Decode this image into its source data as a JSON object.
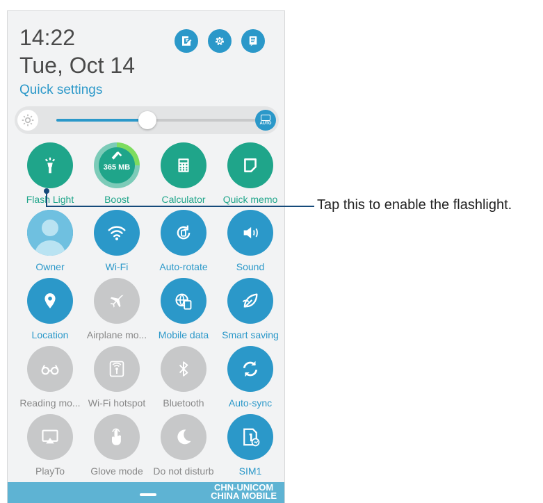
{
  "header": {
    "time": "14:22",
    "date": "Tue, Oct 14",
    "quick_settings_label": "Quick settings",
    "buttons": [
      {
        "icon": "edit-icon"
      },
      {
        "icon": "gear-icon"
      },
      {
        "icon": "notes-icon"
      }
    ]
  },
  "brightness": {
    "level": 0.45,
    "auto_label": "AUTO"
  },
  "tiles": [
    {
      "label": "Flash Light",
      "state": "teal",
      "icon": "flashlight-icon"
    },
    {
      "label": "Boost",
      "state": "teal",
      "icon": "boost-icon",
      "value": "365 MB"
    },
    {
      "label": "Calculator",
      "state": "teal",
      "icon": "calculator-icon"
    },
    {
      "label": "Quick memo",
      "state": "teal",
      "icon": "memo-icon"
    },
    {
      "label": "Owner",
      "state": "on",
      "icon": "avatar-icon"
    },
    {
      "label": "Wi-Fi",
      "state": "on",
      "icon": "wifi-icon"
    },
    {
      "label": "Auto-rotate",
      "state": "on",
      "icon": "rotate-icon"
    },
    {
      "label": "Sound",
      "state": "on",
      "icon": "sound-icon"
    },
    {
      "label": "Location",
      "state": "on",
      "icon": "location-icon"
    },
    {
      "label": "Airplane mo...",
      "state": "off",
      "icon": "airplane-icon"
    },
    {
      "label": "Mobile data",
      "state": "on",
      "icon": "mobile-data-icon"
    },
    {
      "label": "Smart saving",
      "state": "on",
      "icon": "leaf-icon"
    },
    {
      "label": "Reading mo...",
      "state": "off",
      "icon": "glasses-icon"
    },
    {
      "label": "Wi-Fi hotspot",
      "state": "off",
      "icon": "hotspot-icon"
    },
    {
      "label": "Bluetooth",
      "state": "off",
      "icon": "bluetooth-icon"
    },
    {
      "label": "Auto-sync",
      "state": "on",
      "icon": "sync-icon"
    },
    {
      "label": "PlayTo",
      "state": "off",
      "icon": "playto-icon"
    },
    {
      "label": "Glove mode",
      "state": "off",
      "icon": "glove-icon"
    },
    {
      "label": "Do not disturb",
      "state": "off",
      "icon": "moon-icon"
    },
    {
      "label": "SIM1",
      "state": "on",
      "icon": "sim-icon"
    }
  ],
  "navbar": {
    "carrier_line1": "CHN-UNICOM",
    "carrier_line2": "CHINA MOBILE"
  },
  "callout": {
    "text": "Tap this to enable the flashlight."
  },
  "colors": {
    "accent": "#2b98c9",
    "teal": "#1fa58a",
    "off": "#c7c8c9",
    "callout": "#154a7a"
  }
}
